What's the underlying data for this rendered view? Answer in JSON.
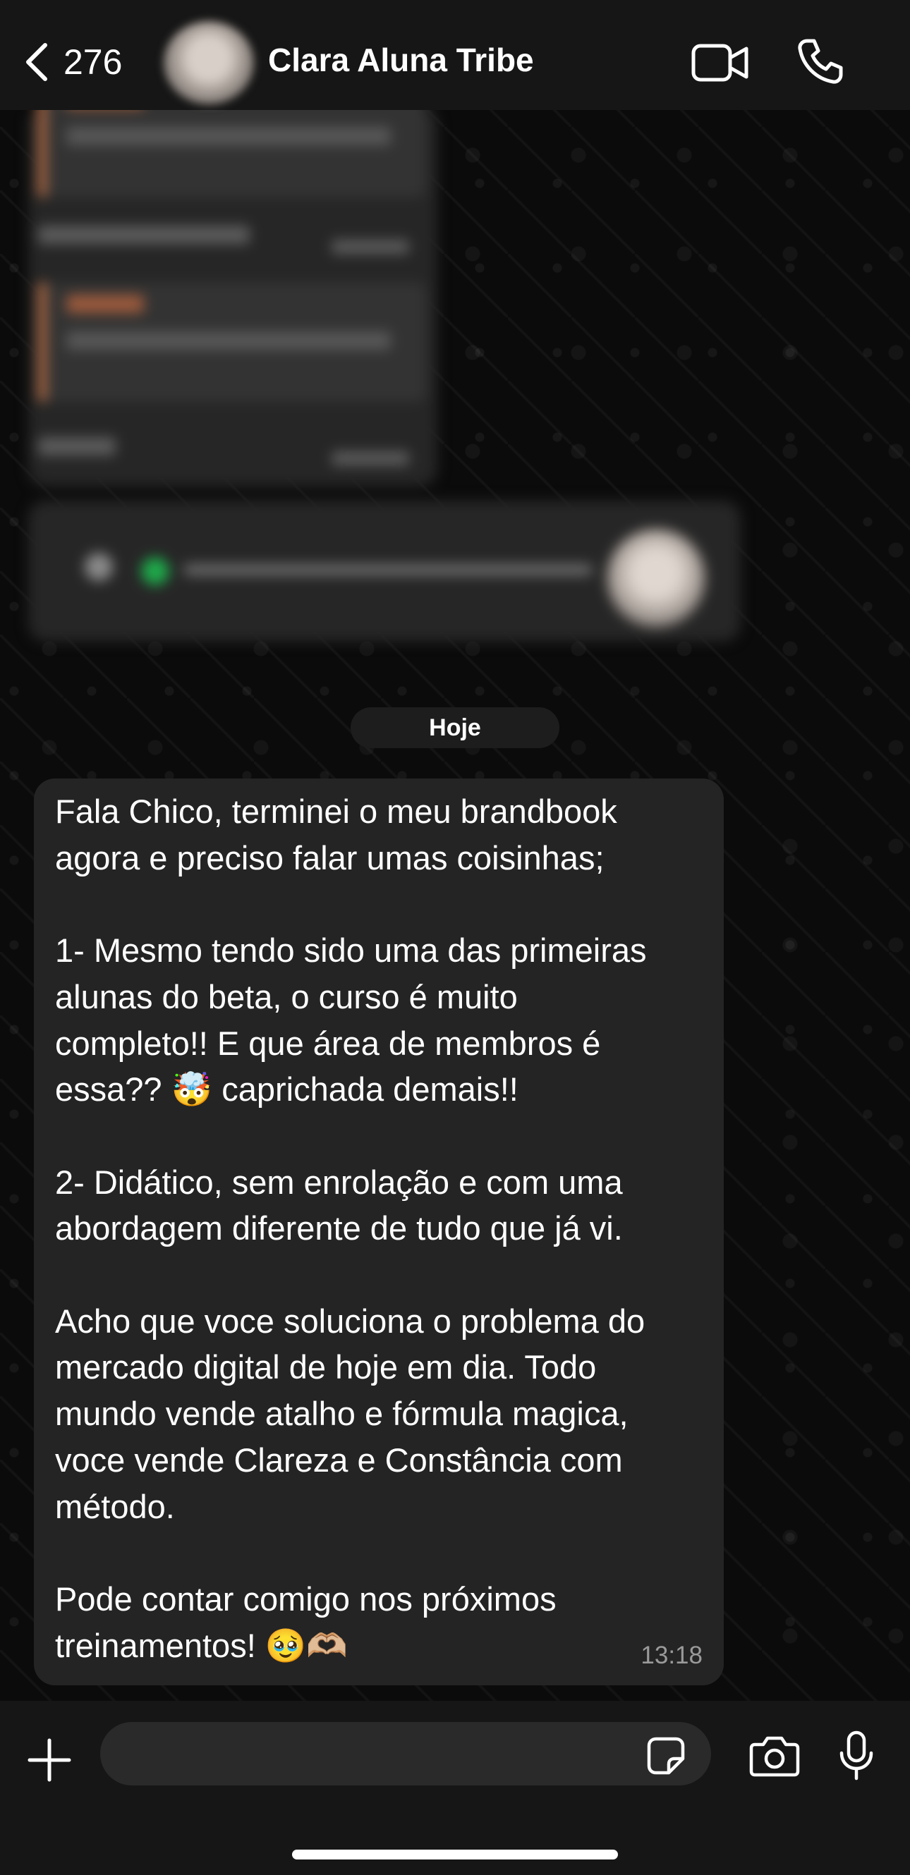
{
  "header": {
    "back_count": "276",
    "contact_name": "Clara Aluna Tribe",
    "icons": {
      "back": "chevron-left-icon",
      "video": "video-camera-icon",
      "call": "phone-icon"
    }
  },
  "date_chip": "Hoje",
  "message": {
    "text": "Fala Chico, terminei o meu brandbook\nagora e preciso falar umas coisinhas;\n\n1- Mesmo tendo sido uma das primeiras\nalunas do beta, o curso é muito\ncompleto!! E que área de membros é\nessa?? 🤯 caprichada demais!!\n\n2- Didático, sem enrolação e com uma\nabordagem diferente de tudo que já vi.\n\nAcho que voce soluciona o problema do\nmercado digital de hoje em dia. Todo\nmundo vende atalho e fórmula magica,\nvoce vende Clareza e Constância com\nmétodo.\n\nPode contar comigo nos próximos\ntreinamentos! 🥹🫶🏼",
    "time": "13:18"
  },
  "composer": {
    "icons": {
      "add": "plus-icon",
      "sticker": "sticker-icon",
      "camera": "camera-icon",
      "mic": "microphone-icon"
    }
  },
  "colors": {
    "background": "#0b0b0b",
    "header": "#161616",
    "bubble": "#242424",
    "accent_quote": "#b46c45"
  }
}
